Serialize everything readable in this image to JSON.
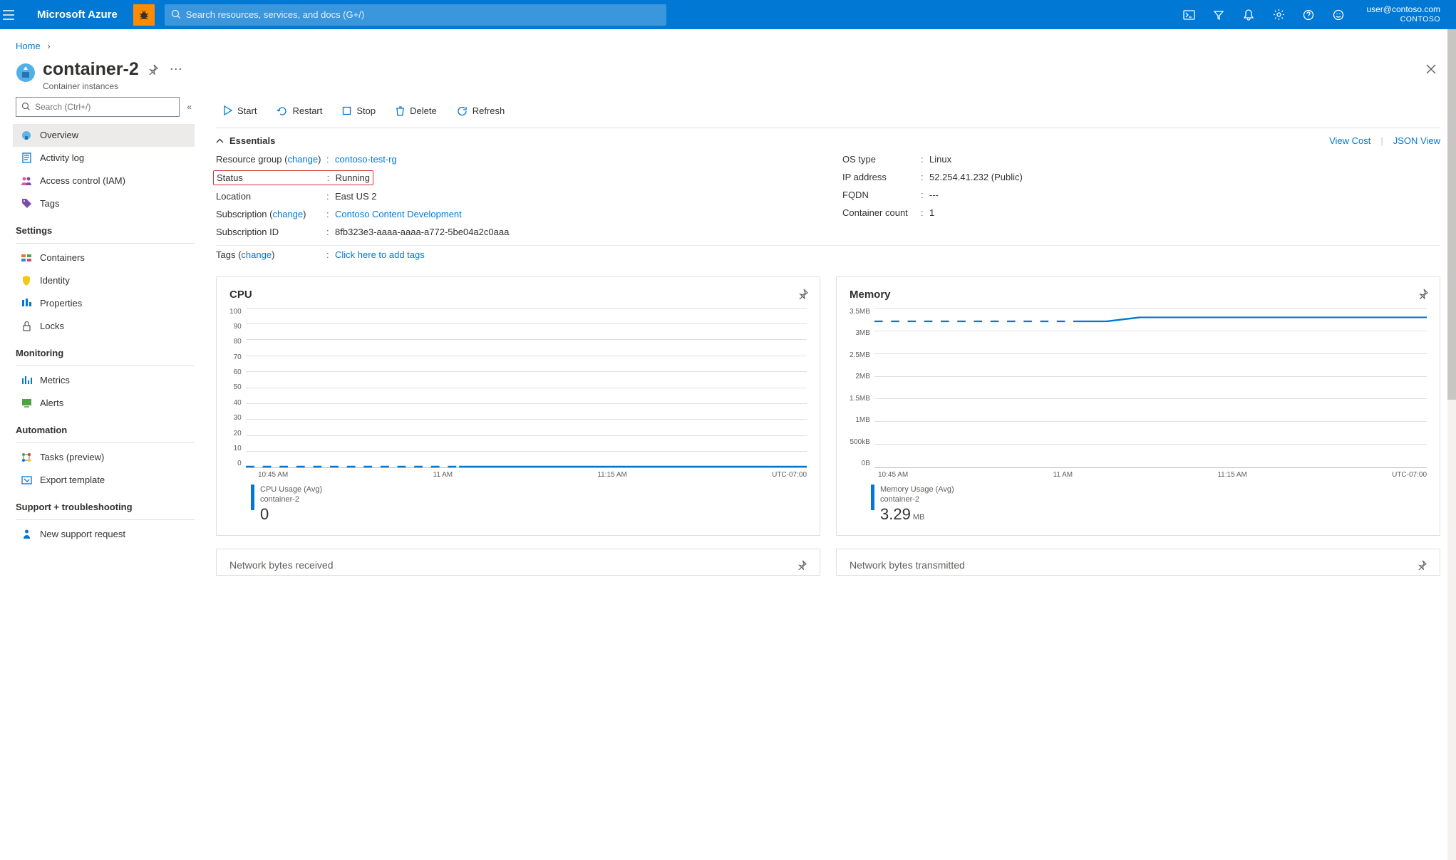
{
  "header": {
    "brand": "Microsoft Azure",
    "search_placeholder": "Search resources, services, and docs (G+/)",
    "user_email": "user@contoso.com",
    "tenant": "CONTOSO"
  },
  "breadcrumb": {
    "home": "Home"
  },
  "resource": {
    "title": "container-2",
    "subtitle": "Container instances"
  },
  "leftnav": {
    "search_placeholder": "Search (Ctrl+/)",
    "items_top": [
      {
        "label": "Overview",
        "icon": "overview",
        "active": true
      },
      {
        "label": "Activity log",
        "icon": "activity"
      },
      {
        "label": "Access control (IAM)",
        "icon": "iam"
      },
      {
        "label": "Tags",
        "icon": "tags"
      }
    ],
    "section_settings": "Settings",
    "items_settings": [
      {
        "label": "Containers",
        "icon": "containers"
      },
      {
        "label": "Identity",
        "icon": "identity"
      },
      {
        "label": "Properties",
        "icon": "properties"
      },
      {
        "label": "Locks",
        "icon": "locks"
      }
    ],
    "section_monitoring": "Monitoring",
    "items_monitoring": [
      {
        "label": "Metrics",
        "icon": "metrics"
      },
      {
        "label": "Alerts",
        "icon": "alerts"
      }
    ],
    "section_automation": "Automation",
    "items_automation": [
      {
        "label": "Tasks (preview)",
        "icon": "tasks"
      },
      {
        "label": "Export template",
        "icon": "export"
      }
    ],
    "section_support": "Support + troubleshooting",
    "items_support": [
      {
        "label": "New support request",
        "icon": "support"
      }
    ]
  },
  "toolbar": {
    "start": "Start",
    "restart": "Restart",
    "stop": "Stop",
    "delete": "Delete",
    "refresh": "Refresh"
  },
  "essentials": {
    "header": "Essentials",
    "view_cost": "View Cost",
    "json_view": "JSON View",
    "left": {
      "resource_group_label": "Resource group (",
      "change": "change",
      "resource_group_value": "contoso-test-rg",
      "status_label": "Status",
      "status_value": "Running",
      "location_label": "Location",
      "location_value": "East US 2",
      "subscription_label": "Subscription (",
      "subscription_value": "Contoso Content Development",
      "subscription_id_label": "Subscription ID",
      "subscription_id_value": "8fb323e3-aaaa-aaaa-a772-5be04a2c0aaa",
      "tags_label": "Tags (",
      "tags_value": "Click here to add tags"
    },
    "right": {
      "os_label": "OS type",
      "os_value": "Linux",
      "ip_label": "IP address",
      "ip_value": "52.254.41.232 (Public)",
      "fqdn_label": "FQDN",
      "fqdn_value": "---",
      "count_label": "Container count",
      "count_value": "1"
    }
  },
  "charts": {
    "cpu": {
      "title": "CPU",
      "legend_title": "CPU Usage (Avg)",
      "legend_sub": "container-2",
      "value": "0"
    },
    "memory": {
      "title": "Memory",
      "legend_title": "Memory Usage (Avg)",
      "legend_sub": "container-2",
      "value": "3.29",
      "unit": "MB"
    }
  },
  "lower": {
    "recv": "Network bytes received",
    "trans": "Network bytes transmitted"
  },
  "chart_data": [
    {
      "type": "line",
      "title": "CPU",
      "ylabel": "CPU Usage (Avg)",
      "ylim": [
        0,
        100
      ],
      "yticks": [
        0,
        10,
        20,
        30,
        40,
        50,
        60,
        70,
        80,
        90,
        100
      ],
      "xticks": [
        "10:45 AM",
        "11 AM",
        "11:15 AM",
        "UTC-07:00"
      ],
      "series": [
        {
          "name": "container-2",
          "x": [
            "10:30",
            "10:45",
            "11:00",
            "11:15",
            "11:30"
          ],
          "values": [
            0,
            0,
            0,
            0,
            0
          ],
          "dashed_until": "11:00"
        }
      ]
    },
    {
      "type": "line",
      "title": "Memory",
      "ylabel": "Memory Usage (Avg)",
      "ylim": [
        0,
        3.5
      ],
      "yticks": [
        "0B",
        "500kB",
        "1MB",
        "1.5MB",
        "2MB",
        "2.5MB",
        "3MB",
        "3.5MB"
      ],
      "xticks": [
        "10:45 AM",
        "11 AM",
        "11:15 AM",
        "UTC-07:00"
      ],
      "series": [
        {
          "name": "container-2",
          "x": [
            "10:30",
            "10:45",
            "11:00",
            "11:05",
            "11:15",
            "11:30"
          ],
          "values": [
            3.2,
            3.2,
            3.2,
            3.29,
            3.29,
            3.29
          ],
          "dashed_until": "11:00"
        }
      ]
    }
  ]
}
